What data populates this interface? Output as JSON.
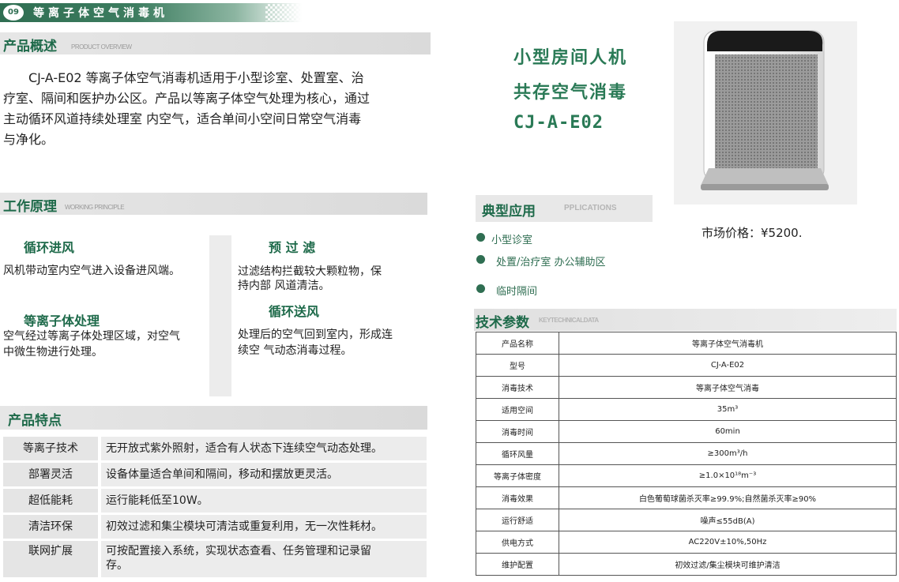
{
  "badge": {
    "number": "09",
    "title": "等离子体空气消毒机"
  },
  "overview": {
    "title": "产品概述",
    "subtitle": "PRODUCT OVERVIEW",
    "lines": [
      "CJ-A-E02  等离子体空气消毒机适用于小型诊室、处置室、治",
      "疗室、隔间和医护办公区。产品以等离子体空气处理为核心，通过",
      "主动循环风道持续处理室 内空气，适合单间小空间日常空气消毒",
      "与净化。"
    ]
  },
  "principle": {
    "title": "工作原理",
    "subtitle": "WORKING PRINCIPLE",
    "steps": [
      {
        "title": "循环进风",
        "desc": [
          "风机带动室内空气进入设备进风端。"
        ]
      },
      {
        "title": "预 过 滤",
        "desc": [
          "过滤结构拦截较大颗粒物，保",
          "持内部 风道清洁。"
        ]
      },
      {
        "title": "等离子体处理",
        "desc": [
          "空气经过等离子体处理区域，对空气",
          "中微生物进行处理。"
        ]
      },
      {
        "title": "循环送风",
        "desc": [
          "处理后的空气回到室内，形成连",
          "续空 气动态消毒过程。"
        ]
      }
    ]
  },
  "features": {
    "title": "产品特点",
    "rows": [
      {
        "key": "等离子技术",
        "value": "无开放式紫外照射，适合有人状态下连续空气动态处理。"
      },
      {
        "key": "部署灵活",
        "value": "设备体量适合单间和隔间，移动和摆放更灵活。"
      },
      {
        "key": "超低能耗",
        "value": "运行能耗低至10W。"
      },
      {
        "key": "清洁环保",
        "value": "初效过滤和集尘模块可清洁或重复利用，无一次性耗材。"
      },
      {
        "key": "联网扩展",
        "value": "可按配置接入系统，实现状态查看、任务管理和记录留",
        "value2": "存。"
      }
    ]
  },
  "hero": {
    "line1": "小型房间人机",
    "line2": "共存空气消毒",
    "line3": "CJ-A-E02"
  },
  "price": "市场价格：¥5200.",
  "applications": {
    "title": "典型应用",
    "subtitle": "PPLICATIONS",
    "items": [
      "小型诊室",
      "处置/治疗室 办公辅助区",
      "临时隔间"
    ]
  },
  "specs": {
    "title": "技术参数",
    "subtitle": "KEYTECHNICALDATA",
    "rows": [
      {
        "key": "产品名称",
        "value": "等离子体空气消毒机"
      },
      {
        "key": "型号",
        "value": "CJ-A-E02"
      },
      {
        "key": "消毒技术",
        "value": "等离子体空气消毒"
      },
      {
        "key": "适用空间",
        "value": "35m³"
      },
      {
        "key": "消毒时间",
        "value": "60min"
      },
      {
        "key": "循环风量",
        "value": "≥300m³/h"
      },
      {
        "key": "等离子体密度",
        "value": "≥1.0×10¹⁸m⁻³"
      },
      {
        "key": "消毒效果",
        "value": "白色葡萄球菌杀灭率≥99.9%;自然菌杀灭率≥90%"
      },
      {
        "key": "运行舒适",
        "value": "噪声≤55dB(A)"
      },
      {
        "key": "供电方式",
        "value": "AC220V±10%,50Hz"
      },
      {
        "key": "维护配置",
        "value": "初效过滤/集尘模块可维护清洁"
      }
    ]
  }
}
